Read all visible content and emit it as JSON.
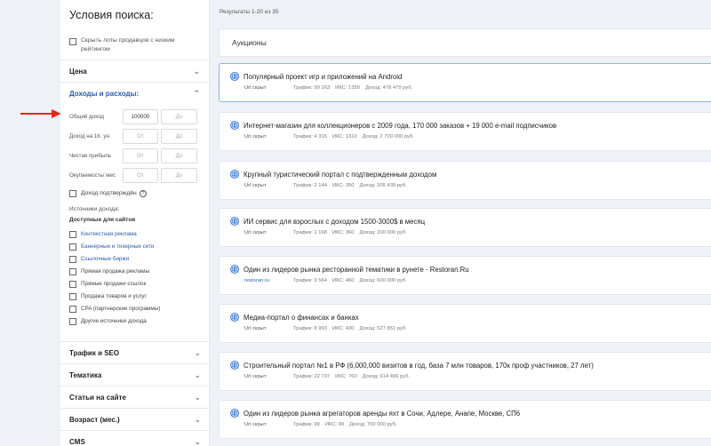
{
  "results_count": "Результаты 1-20 из 35",
  "sidebar": {
    "title": "Условия поиска:",
    "hide_low_rating": "Скрыть лоты продавцов с низким рейтингом",
    "sections_top": [
      {
        "label": "Цена",
        "open": false
      },
      {
        "label": "Доходы и расходы:",
        "open": true
      }
    ],
    "fields": [
      {
        "label": "Общий доход",
        "from": "100000",
        "to": "До"
      },
      {
        "label": "Доход на 1К. ун.",
        "from": "От",
        "to": "До"
      },
      {
        "label": "Чистая прибыль",
        "from": "От",
        "to": "До"
      },
      {
        "label": "Окупаемость/ мес",
        "from": "От",
        "to": "До"
      }
    ],
    "income_confirmed": "Доход подтверждён",
    "sources_title": "Источники дохода:",
    "sources_subtitle": "Доступные для сайтов",
    "sources": [
      {
        "label": "Контекстная реклама",
        "link": true
      },
      {
        "label": "Баннерные и тизерные сети",
        "link": true
      },
      {
        "label": "Ссылочные биржи",
        "link": true
      },
      {
        "label": "Прямая продажа рекламы",
        "link": false
      },
      {
        "label": "Прямые продажи ссылок",
        "link": false
      },
      {
        "label": "Продажа товаров и услуг",
        "link": false
      },
      {
        "label": "CPA (партнерские программы)",
        "link": false
      },
      {
        "label": "Другие источники дохода",
        "link": false
      }
    ],
    "sections_bottom": [
      {
        "label": "Трафик и SEO"
      },
      {
        "label": "Тематика"
      },
      {
        "label": "Статьи на сайте"
      },
      {
        "label": "Возраст (мес.)"
      },
      {
        "label": "CMS"
      }
    ]
  },
  "auction_label": "Аукционы",
  "lots": [
    {
      "title": "Популярный проект игр и приложений на Android",
      "url": "Url скрыт",
      "traffic": "Трафик: 99 263",
      "iks": "ИКС: 1350",
      "income": "Доход: 478 479 руб.",
      "highlight": true
    },
    {
      "title": "Интернет-магазин для коллекционеров с 2009 года, 170 000 заказов + 19 000 e-mail подписчиков",
      "url": "Url скрыт",
      "traffic": "Трафик: 4 316",
      "iks": "ИКС: 1310",
      "income": "Доход: 2 700 000 руб.",
      "highlight": false
    },
    {
      "title": "Крупный туристический портал с подтвержденным доходом",
      "url": "Url скрыт",
      "traffic": "Трафик: 2 144",
      "iks": "ИКС: 350",
      "income": "Доход: 205 439 руб.",
      "highlight": false
    },
    {
      "title": "ИИ сервис для взрослых с доходом 1500-3000$ в месяц",
      "url": "Url скрыт",
      "traffic": "Трафик: 1 168",
      "iks": "ИКС: 360",
      "income": "Доход: 200 000 руб.",
      "highlight": false
    },
    {
      "title": "Один из лидеров рынка ресторанной тематики в рунете - Restoran.Ru",
      "url": "restoran.ru",
      "traffic": "Трафик: 9 564",
      "iks": "ИКС: 460",
      "income": "Доход: 600 000 руб.",
      "highlight": false,
      "url_link": true
    },
    {
      "title": "Медиа-портал о финансах и банках",
      "url": "Url скрыт",
      "traffic": "Трафик: 8 993",
      "iks": "ИКС: 430",
      "income": "Доход: 527 851 руб.",
      "highlight": false
    },
    {
      "title": "Строительный портал №1 в РФ (6,000,000 визитов в год, база 7 млн товаров, 170к проф участников, 27 лет)",
      "url": "Url скрыт",
      "traffic": "Трафик: 22 737",
      "iks": "ИКС: 760",
      "income": "Доход: 914 499 руб.",
      "highlight": false
    },
    {
      "title": "Один из лидеров рынка агрегаторов аренды яхт в Сочи, Адлере, Анапе, Москве, СП6",
      "url": "Url скрыт",
      "traffic": "Трафик: 99",
      "iks": "ИКС: 90",
      "income": "Доход: 700 000 руб.",
      "highlight": false
    }
  ],
  "colors": {
    "accent": "#2a5ca8",
    "arrow": "#e8231e",
    "highlight_border": "#8fb4e8"
  }
}
